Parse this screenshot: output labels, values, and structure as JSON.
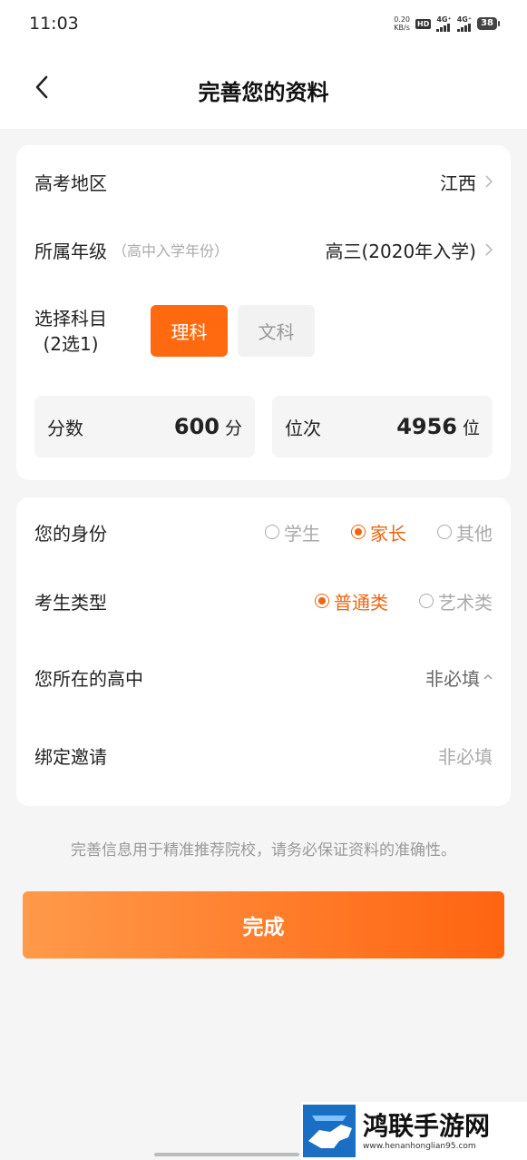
{
  "status_bar": {
    "time": "11:03",
    "net_speed_value": "0.20",
    "net_speed_unit": "KB/s",
    "hd_label": "HD",
    "signal1_label": "4G⁺",
    "signal2_label": "4G⁺",
    "battery": "38"
  },
  "nav": {
    "title": "完善您的资料"
  },
  "profile": {
    "region_label": "高考地区",
    "region_value": "江西",
    "grade_label": "所属年级",
    "grade_hint": "（高中入学年份）",
    "grade_value": "高三(2020年入学)",
    "subject_label_line1": "选择科目",
    "subject_label_line2": "(2选1)",
    "subject_options": [
      "理科",
      "文科"
    ],
    "selected_subject": "理科",
    "score_label": "分数",
    "score_value": "600",
    "score_unit": "分",
    "rank_label": "位次",
    "rank_value": "4956",
    "rank_unit": "位"
  },
  "identity": {
    "identity_label": "您的身份",
    "identity_options": [
      "学生",
      "家长",
      "其他"
    ],
    "identity_selected": "家长",
    "type_label": "考生类型",
    "type_options": [
      "普通类",
      "艺术类"
    ],
    "type_selected": "普通类",
    "school_label": "您所在的高中",
    "school_value": "非必填",
    "invite_label": "绑定邀请",
    "invite_placeholder": "非必填"
  },
  "notice": "完善信息用于精准推荐院校，请务必保证资料的准确性。",
  "done_label": "完成",
  "watermark": {
    "title": "鸿联手游网",
    "url": "www.henanhonglian95.com"
  },
  "colors": {
    "accent": "#ff6a10",
    "background": "#f5f5f5"
  }
}
